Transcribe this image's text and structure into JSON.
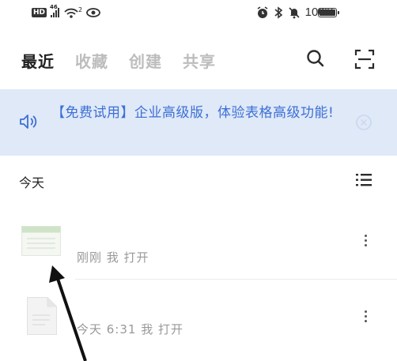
{
  "status_bar": {
    "hd": "HD",
    "network": "46",
    "wifi_superscript": "2",
    "battery": "100%",
    "battery_level_percent": 100
  },
  "tabs": [
    {
      "label": "最近",
      "active": true
    },
    {
      "label": "收藏",
      "active": false
    },
    {
      "label": "创建",
      "active": false
    },
    {
      "label": "共享",
      "active": false
    }
  ],
  "header_icons": [
    "search-icon",
    "scan-icon"
  ],
  "banner": {
    "text": "【免费试用】企业高级版，体验表格高级功能!",
    "icon": "speaker-icon",
    "close_icon": "close-circle-icon"
  },
  "section": {
    "title": "今天",
    "view_icon": "list-view-icon"
  },
  "files": [
    {
      "meta": "刚刚 我 打开",
      "icon": "spreadsheet-file-icon"
    },
    {
      "meta": "今天 6:31 我 打开",
      "icon": "document-file-icon"
    }
  ],
  "colors": {
    "accent": "#3d6fd6",
    "banner_bg": "#dfe9f7",
    "tab_active": "#1f1f1f",
    "tab_inactive": "#bdbdbd"
  }
}
